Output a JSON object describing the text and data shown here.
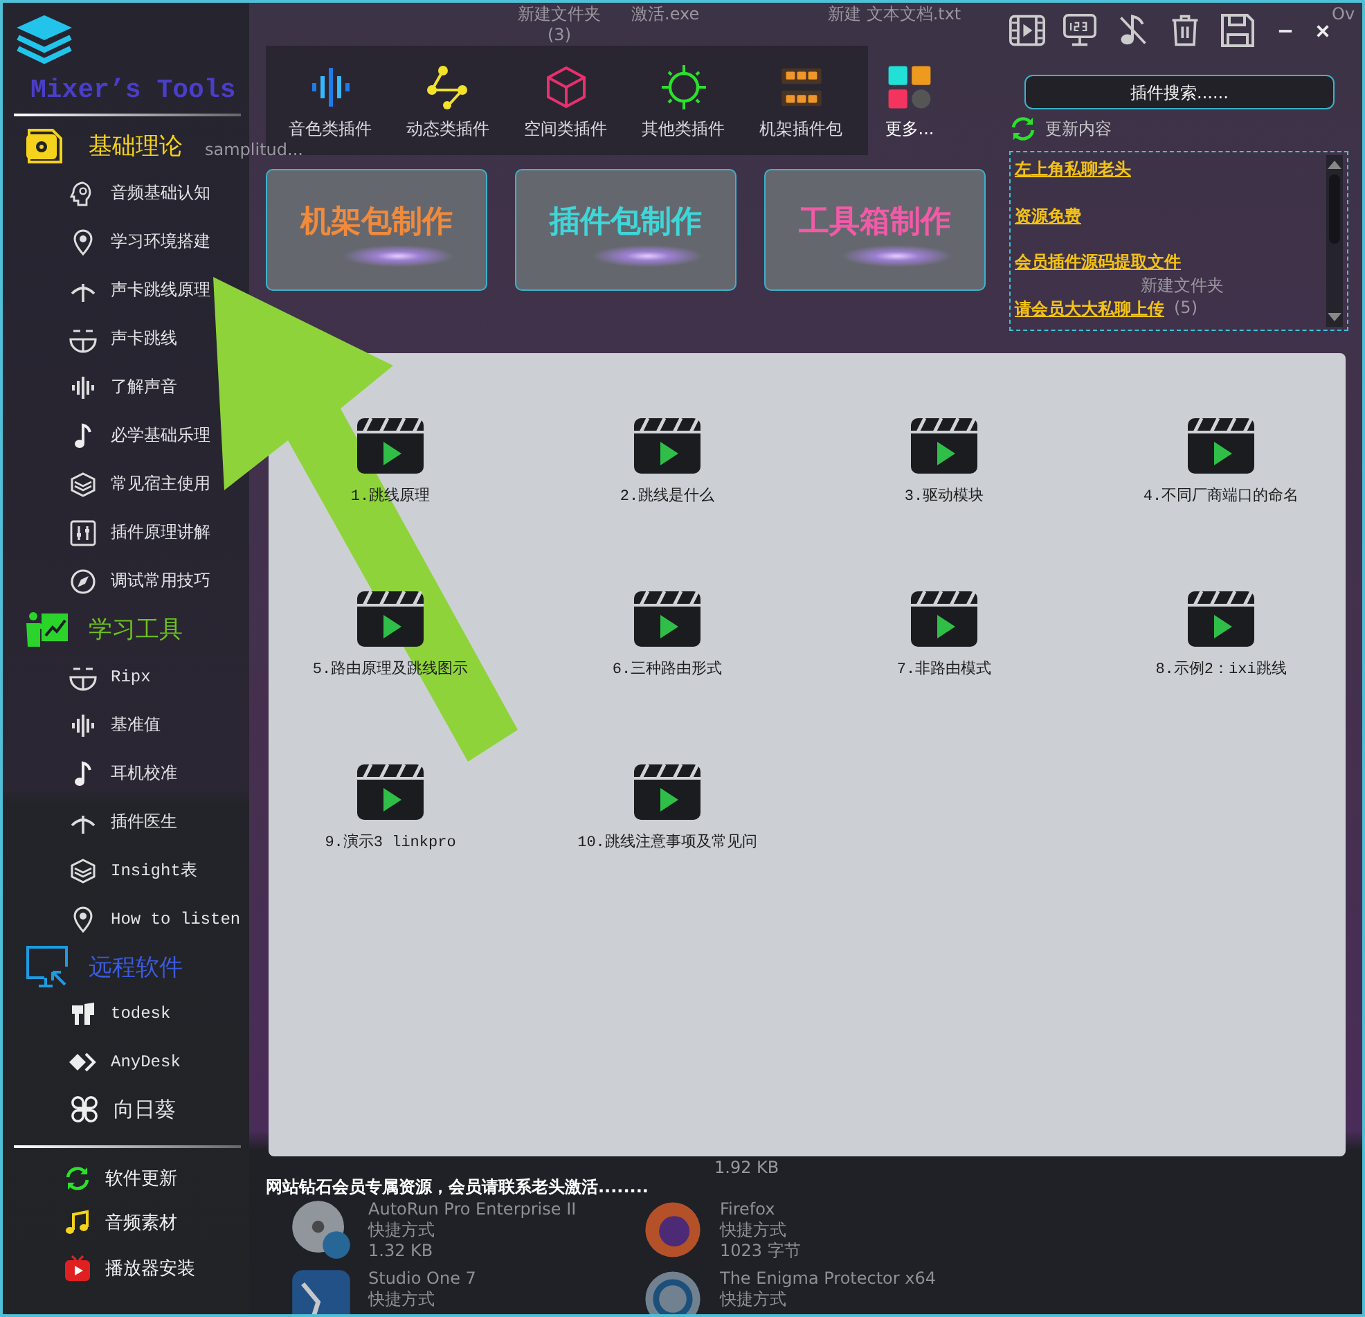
{
  "sidebar": {
    "title": "Mixer’s Tools",
    "sections": [
      {
        "title": "基础理论",
        "color": "#f5d31c",
        "items": [
          "音频基础认知",
          "学习环境搭建",
          "声卡跳线原理",
          "声卡跳线",
          "了解声音",
          "必学基础乐理",
          "常见宿主使用",
          "插件原理讲解",
          "调试常用技巧"
        ]
      },
      {
        "title": "学习工具",
        "color": "#6ec21e",
        "items": [
          "Ripx",
          "基准值",
          "耳机校准",
          "插件医生",
          "Insight表",
          "How to listen"
        ]
      },
      {
        "title": "远程软件",
        "color": "#3b5bdc",
        "items": [
          "todesk",
          "AnyDesk",
          "向日葵"
        ]
      }
    ],
    "footer_items": [
      "软件更新",
      "音频素材",
      "播放器安装"
    ]
  },
  "toolbar": {
    "categories": [
      "音色类插件",
      "动态类插件",
      "空间类插件",
      "其他类插件",
      "机架插件包"
    ],
    "more": "更多..."
  },
  "banners": [
    {
      "label": "机架包制作",
      "color": "#f08a3c"
    },
    {
      "label": "插件包制作",
      "color": "#3fd6d8"
    },
    {
      "label": "工具箱制作",
      "color": "#f25aa8"
    }
  ],
  "search": {
    "placeholder": "插件搜索......"
  },
  "updates": {
    "title": "更新内容",
    "links": [
      "左上角私聊老头",
      "资源免费",
      "会员插件源码提取文件",
      "请会员大大私聊上传"
    ]
  },
  "videos": [
    "1.跳线原理",
    "2.跳线是什么",
    "3.驱动模块",
    "4.不同厂商端口的命名",
    "5.路由原理及跳线图示",
    "6.三种路由形式",
    "7.非路由模式",
    "8.示例2：ixi跳线",
    "9.演示3 linkpro",
    "10.跳线注意事项及常见问"
  ],
  "notice": "网站钻石会员专属资源，会员请联系老头激活........",
  "desktop": {
    "labels": [
      "新建文件夹\n(3)",
      "激活.exe",
      "新建 文本文档.txt",
      "samplitud...",
      "新建文件夹",
      "(5)",
      "Ov",
      "1.92 KB"
    ],
    "tiles": [
      {
        "name": "AutoRun Pro Enterprise II",
        "type": "快捷方式",
        "size": "1.32 KB"
      },
      {
        "name": "Firefox",
        "type": "快捷方式",
        "size": "1023 字节"
      },
      {
        "name": "Studio One 7",
        "type": "快捷方式"
      },
      {
        "name": "The Enigma Protector x64",
        "type": "快捷方式"
      }
    ]
  }
}
